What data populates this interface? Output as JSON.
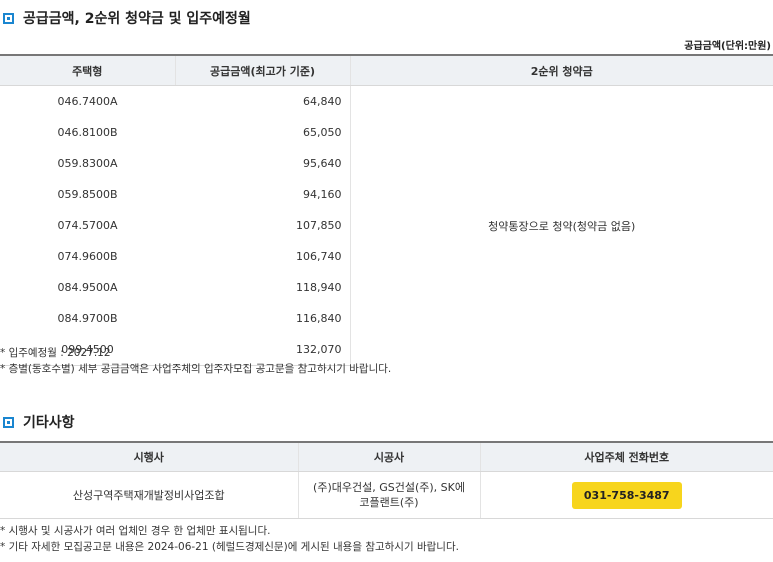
{
  "section1": {
    "title": "공급금액, 2순위 청약금 및 입주예정월",
    "unit_label": "공급금액(단위:만원)",
    "headers": [
      "주택형",
      "공급금액(최고가 기준)",
      "2순위 청약금"
    ],
    "rows": [
      {
        "type": "046.7400A",
        "price": "64,840"
      },
      {
        "type": "046.8100B",
        "price": "65,050"
      },
      {
        "type": "059.8300A",
        "price": "95,640"
      },
      {
        "type": "059.8500B",
        "price": "94,160"
      },
      {
        "type": "074.5700A",
        "price": "107,850"
      },
      {
        "type": "074.9600B",
        "price": "106,740"
      },
      {
        "type": "084.9500A",
        "price": "118,940"
      },
      {
        "type": "084.9700B",
        "price": "116,840"
      },
      {
        "type": "099.4500",
        "price": "132,070"
      }
    ],
    "merged_value": "청약통장으로 청약(청약금 없음)",
    "notes": [
      "* 입주예정월 : 2027.12",
      "* 층별(동호수별) 세부 공급금액은 사업주체의 입주자모집 공고문을 참고하시기 바랍니다."
    ]
  },
  "section2": {
    "title": "기타사항",
    "headers": [
      "시행사",
      "시공사",
      "사업주체 전화번호"
    ],
    "row": {
      "developer": "산성구역주택재개발정비사업조합",
      "builder_line1": "(주)대우건설, GS건설(주), SK에",
      "builder_line2": "코플랜트(주)",
      "phone": "031-758-3487"
    },
    "notes": [
      "* 시행사 및 시공사가 여러 업체인 경우 한 업체만 표시됩니다.",
      "* 기타 자세한 모집공고문 내용은 2024-06-21 (헤럴드경제신문)에 게시된 내용을 참고하시기 바랍니다."
    ]
  },
  "colors": {
    "accent": "#1a86d0",
    "header_bg": "#eef1f4",
    "phone_bg": "#f7d51d"
  },
  "icons": [
    "square-bullet-icon"
  ]
}
